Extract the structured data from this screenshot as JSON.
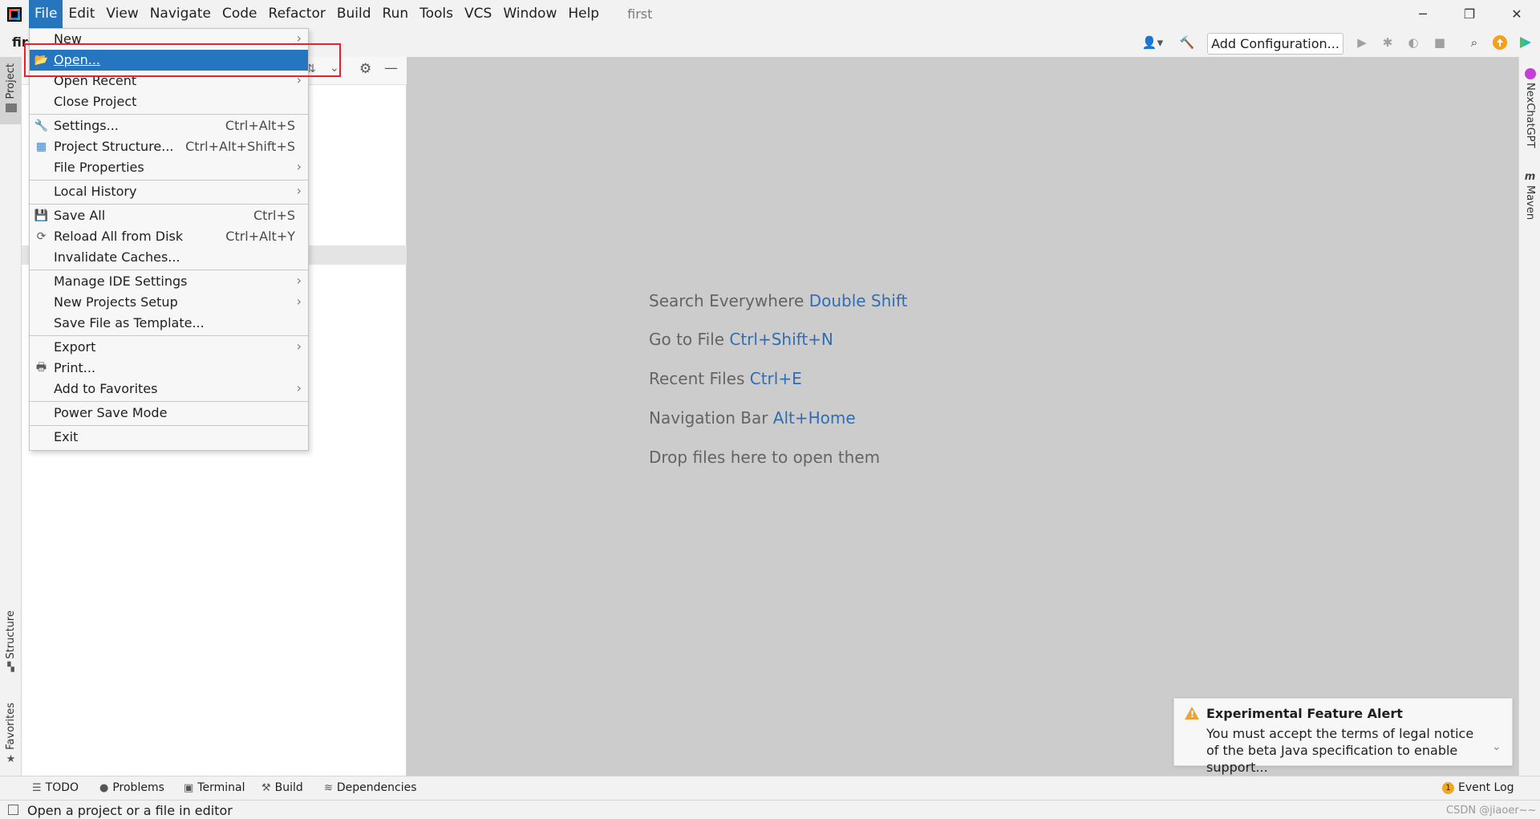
{
  "window": {
    "project_title": "first",
    "minimize": "─",
    "restore": "❐",
    "close": "✕"
  },
  "menubar": {
    "items": [
      "File",
      "Edit",
      "View",
      "Navigate",
      "Code",
      "Refactor",
      "Build",
      "Run",
      "Tools",
      "VCS",
      "Window",
      "Help"
    ],
    "active": "File"
  },
  "toolbar": {
    "breadcrumb": "firs",
    "add_configuration": "Add Configuration..."
  },
  "file_menu": {
    "items": [
      {
        "label": "New",
        "submenu": true
      },
      {
        "label": "Open...",
        "selected": true
      },
      {
        "label": "Open Recent",
        "submenu": true
      },
      {
        "label": "Close Project"
      },
      {
        "label": "Settings...",
        "shortcut": "Ctrl+Alt+S"
      },
      {
        "label": "Project Structure...",
        "shortcut": "Ctrl+Alt+Shift+S"
      },
      {
        "label": "File Properties",
        "submenu": true
      },
      {
        "label": "Local History",
        "submenu": true
      },
      {
        "label": "Save All",
        "shortcut": "Ctrl+S"
      },
      {
        "label": "Reload All from Disk",
        "shortcut": "Ctrl+Alt+Y"
      },
      {
        "label": "Invalidate Caches..."
      },
      {
        "label": "Manage IDE Settings",
        "submenu": true
      },
      {
        "label": "New Projects Setup",
        "submenu": true
      },
      {
        "label": "Save File as Template..."
      },
      {
        "label": "Export",
        "submenu": true
      },
      {
        "label": "Print..."
      },
      {
        "label": "Add to Favorites",
        "submenu": true
      },
      {
        "label": "Power Save Mode"
      },
      {
        "label": "Exit"
      }
    ]
  },
  "editor_hints": [
    {
      "text": "Search Everywhere",
      "key": "Double Shift"
    },
    {
      "text": "Go to File",
      "key": "Ctrl+Shift+N"
    },
    {
      "text": "Recent Files",
      "key": "Ctrl+E"
    },
    {
      "text": "Navigation Bar",
      "key": "Alt+Home"
    },
    {
      "text": "Drop files here to open them",
      "key": ""
    }
  ],
  "left_tabs": {
    "project": "Project",
    "structure": "Structure",
    "favorites": "Favorites"
  },
  "right_tabs": {
    "nexchatgpt": "NexChatGPT",
    "maven": "Maven"
  },
  "notification": {
    "title": "Experimental Feature Alert",
    "body": "You must accept the terms of legal notice of the beta Java specification to enable support..."
  },
  "bottom_tabs": {
    "todo": "TODO",
    "problems": "Problems",
    "terminal": "Terminal",
    "build": "Build",
    "dependencies": "Dependencies",
    "event_log": "Event Log",
    "event_log_count": "1"
  },
  "status_bar": {
    "message": "Open a project or a file in editor",
    "watermark": "CSDN @jiaoer~~"
  }
}
